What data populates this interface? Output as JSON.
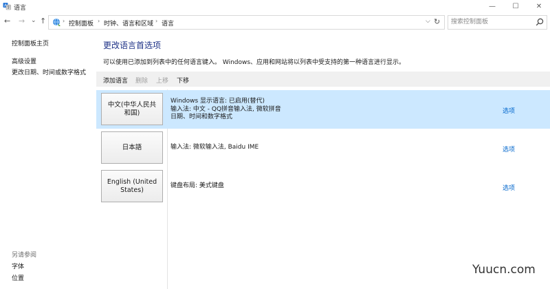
{
  "window": {
    "title": "语言",
    "controls": [
      "—",
      "☐",
      "✕"
    ]
  },
  "breadcrumb": {
    "items": [
      "控制面板",
      "时钟、语言和区域",
      "语言"
    ],
    "separator": "›",
    "leading": "›",
    "dropdown": "⌵",
    "refresh": "↻"
  },
  "nav": {
    "back": "←",
    "forward": "→",
    "recent": "⌄",
    "up": "↑"
  },
  "search": {
    "placeholder": "搜索控制面板",
    "value": ""
  },
  "sidebar": {
    "home": "控制面板主页",
    "links": [
      "高级设置",
      "更改日期、时间或数字格式"
    ],
    "see_also_title": "另请参阅",
    "see_also": [
      "字体",
      "位置"
    ]
  },
  "main": {
    "title": "更改语言首选项",
    "description": "可以使用已添加到列表中的任何语言键入。 Windows、应用和网站将以列表中受支持的第一种语言进行显示。",
    "toolbar": [
      {
        "label": "添加语言",
        "enabled": true
      },
      {
        "label": "删除",
        "enabled": false
      },
      {
        "label": "上移",
        "enabled": false
      },
      {
        "label": "下移",
        "enabled": true
      }
    ],
    "languages": [
      {
        "name_line1": "中文(中华人民共",
        "name_line2": "和国)",
        "info": [
          "Windows 显示语言: 已启用(替代)",
          "输入法: 中文 - QQ拼音输入法, 微软拼音",
          "日期、时间和数字格式"
        ],
        "option": "选项",
        "selected": true
      },
      {
        "name_line1": "日本語",
        "name_line2": "",
        "info": [
          "输入法: 微软输入法, Baidu IME"
        ],
        "option": "选项",
        "selected": false
      },
      {
        "name_line1": "English (United",
        "name_line2": "States)",
        "info": [
          "键盘布局: 美式键盘"
        ],
        "option": "选项",
        "selected": false
      }
    ]
  },
  "watermark": "Yuucn.com",
  "colors": {
    "selected_row": "#cce8ff",
    "link": "#0066cc",
    "title": "#1e3287",
    "toolbar_bg": "#f0f0f0"
  }
}
